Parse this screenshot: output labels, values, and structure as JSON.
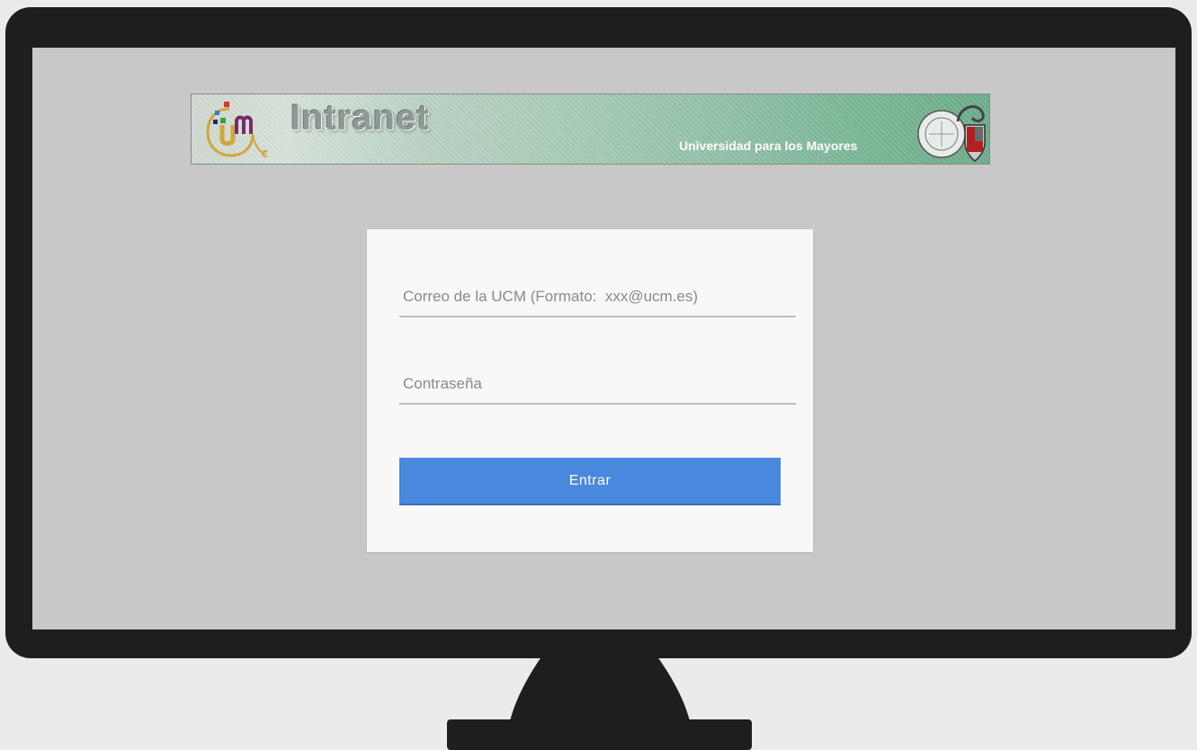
{
  "banner": {
    "title": "Intranet",
    "subtitle": "Universidad para los Mayores"
  },
  "login": {
    "email_placeholder": "Correo de la UCM (Formato:  xxx@ucm.es)",
    "password_placeholder": "Contraseña",
    "submit_label": "Entrar"
  },
  "icons": {
    "logo": "um-logo-icon",
    "seal": "university-seal-icon"
  },
  "colors": {
    "monitor": "#1e1e1e",
    "screen": "#c8c8c8",
    "button": "#4a88dd",
    "card": "#f8f8f8"
  }
}
